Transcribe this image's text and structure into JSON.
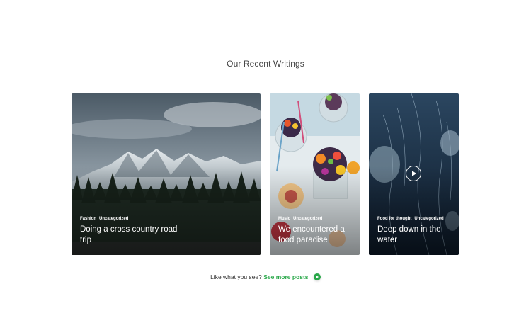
{
  "section": {
    "title": "Our Recent Writings"
  },
  "posts": [
    {
      "tags": [
        "Fashion",
        "Uncategorized"
      ],
      "title": "Doing a cross country road trip",
      "image": "mountain-forest-landscape"
    },
    {
      "tags": [
        "Music",
        "Uncategorized"
      ],
      "title": "We encountered a food paradise",
      "image": "fruit-parfait-glasses"
    },
    {
      "tags": [
        "Food for thought",
        "Uncategorized"
      ],
      "title": "Deep down in the water",
      "image": "jellyfish-underwater",
      "has_video": true,
      "play_icon": "play-icon"
    }
  ],
  "footer": {
    "prompt": "Like what you see?",
    "link_label": "See more posts",
    "link_icon": "arrow-right-circle-icon",
    "accent_color": "#2aa84a"
  }
}
